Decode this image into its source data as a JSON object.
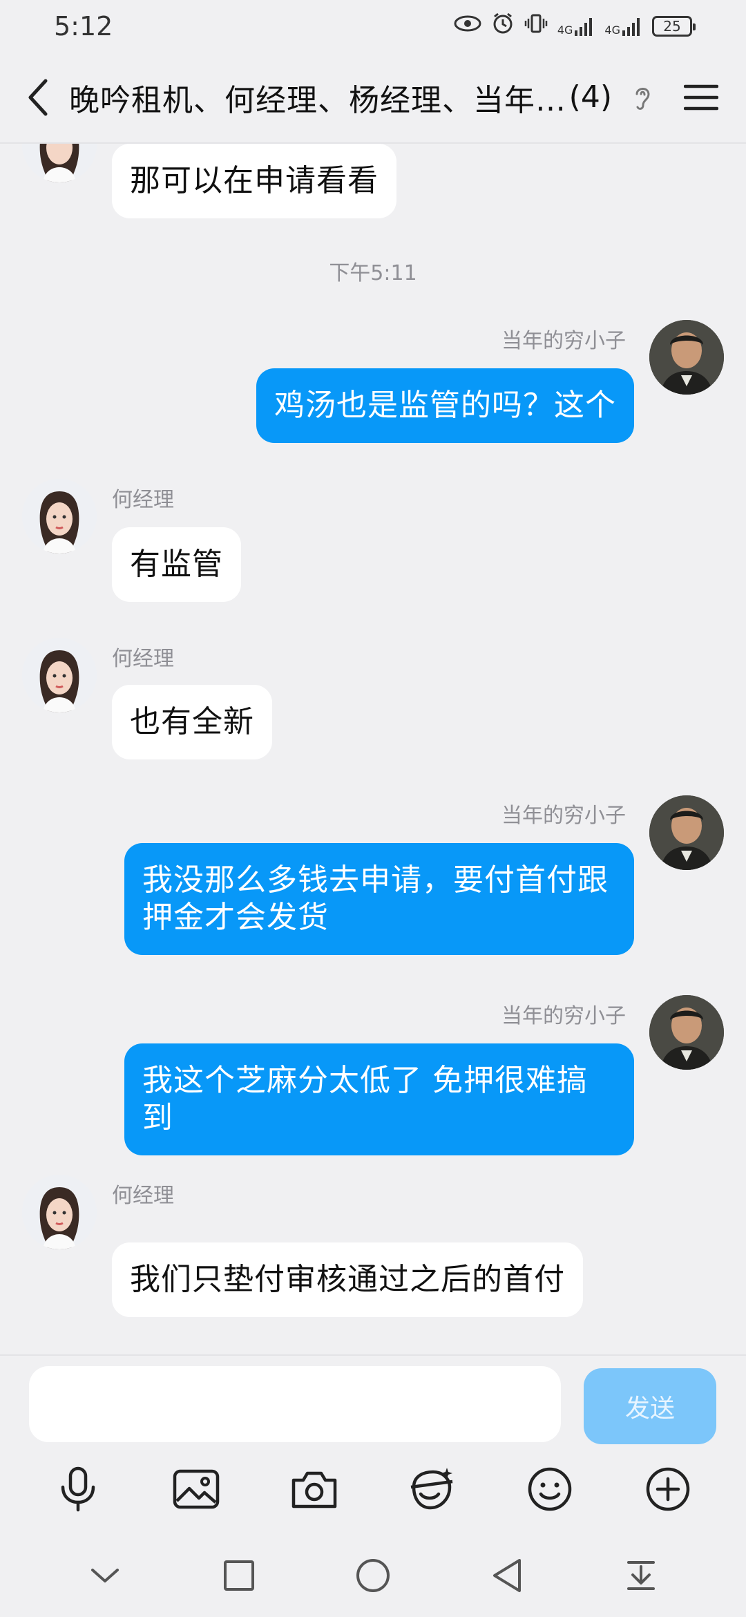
{
  "status_bar": {
    "time": "5:12",
    "battery": "25",
    "net1": "4G",
    "net2": "4G"
  },
  "header": {
    "title": "晚吟租机、何经理、杨经理、当年…",
    "member_count": "(4)"
  },
  "messages": [
    {
      "type": "in",
      "text": "那可以在申请看看"
    },
    {
      "type": "time",
      "text": "下午5:11"
    },
    {
      "type": "out",
      "sender": "当年的穷小子",
      "text": "鸡汤也是监管的吗？这个"
    },
    {
      "type": "in",
      "sender": "何经理",
      "text": "有监管"
    },
    {
      "type": "in",
      "sender": "何经理",
      "text": "也有全新"
    },
    {
      "type": "out",
      "sender": "当年的穷小子",
      "line1": "我没那么多钱去申请，要付首付跟",
      "line2": "押金才会发货"
    },
    {
      "type": "out",
      "sender": "当年的穷小子",
      "line1": "我这个芝麻分太低了 免押很难搞",
      "line2": "到"
    },
    {
      "type": "in",
      "sender": "何经理",
      "text": "我们只垫付审核通过之后的首付"
    }
  ],
  "input": {
    "value": "",
    "send_label": "发送"
  },
  "colors": {
    "accent": "#0898f8",
    "send_disabled": "#7cc6fa",
    "background": "#f0f0f2"
  },
  "toolbar_icons": [
    "mic-icon",
    "image-icon",
    "camera-icon",
    "sticker-icon",
    "emoji-icon",
    "plus-icon"
  ],
  "nav_icons": [
    "chevron-down-icon",
    "recent-apps-icon",
    "home-icon",
    "back-triangle-icon",
    "notification-shade-icon"
  ]
}
